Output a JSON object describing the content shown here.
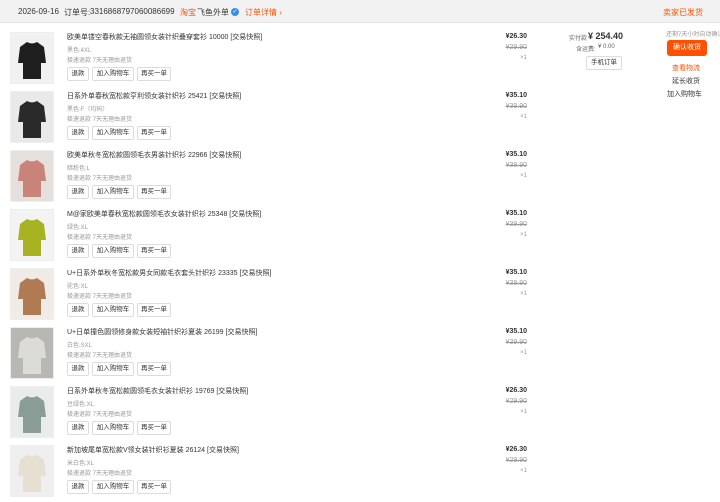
{
  "header": {
    "date": "2026-09-16",
    "order_label": "订单号:",
    "order_no": "3316868797060086699",
    "platform": "淘宝",
    "shop": "飞鱼外单",
    "badge": "✓",
    "detail_link": "订单详情 ›",
    "status": "卖家已发货"
  },
  "summary": {
    "total_label": "实付款",
    "total": "¥ 254.40",
    "shipping_label": "含运费:",
    "shipping": "¥ 0.00",
    "mobile_order": "手机订单",
    "remaining": "还剩7天小时自动确认",
    "confirm": "确认收货",
    "view_logistics": "查看物流",
    "extend": "延长收货",
    "add_cart": "加入购物车"
  },
  "buttons": {
    "refund": "退款",
    "add_cart": "加入购物车",
    "rebuy": "再买一单"
  },
  "service": "极速退款 7天无理由退货",
  "items": [
    {
      "title": "欧美单镂空春秋款无袖圆领女装针织叠穿套衫 10000 [交易快照]",
      "sku": "黑色:4XL",
      "price": "¥26.30",
      "orig": "¥29.90",
      "qty": "×1"
    },
    {
      "title": "日系外单春秋宽松款亨利领女装针织衫 25421 [交易快照]",
      "sku": "黑色:F（均码）",
      "price": "¥35.10",
      "orig": "¥39.90",
      "qty": "×1"
    },
    {
      "title": "欧美单秋冬宽松款圆领毛衣男装针织衫 22966 [交易快照]",
      "sku": "暗粉色:L",
      "price": "¥35.10",
      "orig": "¥39.90",
      "qty": "×1"
    },
    {
      "title": "M@家欧美单春秋宽松款圆领毛衣女装针织衫 25348 [交易快照]",
      "sku": "绿色:XL",
      "price": "¥35.10",
      "orig": "¥39.90",
      "qty": "×1"
    },
    {
      "title": "U+日系外单秋冬宽松款男女同款毛衣套头针织衫 23335 [交易快照]",
      "sku": "驼色:XL",
      "price": "¥35.10",
      "orig": "¥39.90",
      "qty": "×1"
    },
    {
      "title": "U+日单撞色圆领修身款女装短袖针织衫夏装 26199 [交易快照]",
      "sku": "白色:SXL",
      "price": "¥35.10",
      "orig": "¥39.90",
      "qty": "×1"
    },
    {
      "title": "日系外单秋冬宽松款圆领毛衣女装针织衫 19769 [交易快照]",
      "sku": "豆绿色:XL",
      "price": "¥26.30",
      "orig": "¥29.90",
      "qty": "×1"
    },
    {
      "title": "新加坡尾单宽松款V领女装针织衫夏装 26124 [交易快照]",
      "sku": "米白色:XL",
      "price": "¥26.30",
      "orig": "¥29.90",
      "qty": "×1"
    }
  ],
  "colors": {
    "accent": "#ff5000",
    "header_bg": "#f2f2f2",
    "thumb_fills": [
      "#1e1e1e",
      "#2a2a2a",
      "#c9847a",
      "#a7b322",
      "#b07a52",
      "#dcdcd6",
      "#8a9c98",
      "#e6dfd2"
    ],
    "thumb_bg": [
      "#f1f1f1",
      "#e9e9e9",
      "#e5e0db",
      "#f3f3f3",
      "#f0ebe6",
      "#b9b7b3",
      "#e9ece9",
      "#efefef"
    ]
  }
}
